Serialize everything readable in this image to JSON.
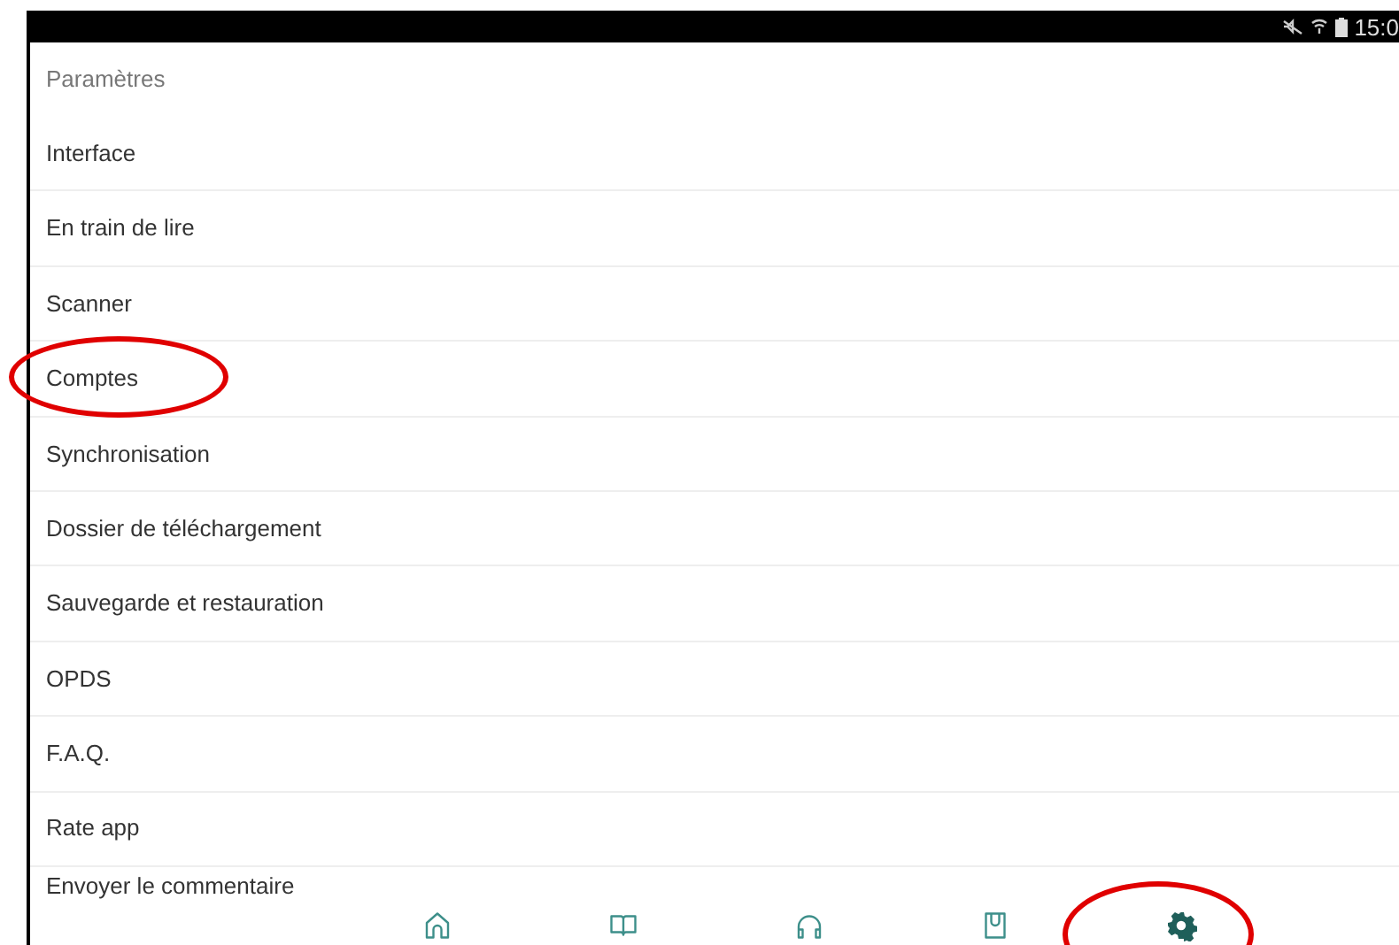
{
  "status_bar": {
    "time": "15:0"
  },
  "header": {
    "title": "Paramètres"
  },
  "items": [
    {
      "label": "Interface",
      "circled": false
    },
    {
      "label": "En train de lire",
      "circled": false
    },
    {
      "label": "Scanner",
      "circled": false
    },
    {
      "label": "Comptes",
      "circled": true
    },
    {
      "label": "Synchronisation",
      "circled": false
    },
    {
      "label": "Dossier de téléchargement",
      "circled": false
    },
    {
      "label": "Sauvegarde et restauration",
      "circled": false
    },
    {
      "label": "OPDS",
      "circled": false
    },
    {
      "label": "F.A.Q.",
      "circled": false
    },
    {
      "label": "Rate app",
      "circled": false
    },
    {
      "label": "Envoyer le commentaire",
      "circled": false
    }
  ],
  "bottom_nav": [
    {
      "kind": "home",
      "selected": false,
      "circled": false
    },
    {
      "kind": "book",
      "selected": false,
      "circled": false
    },
    {
      "kind": "headphones",
      "selected": false,
      "circled": false
    },
    {
      "kind": "bag",
      "selected": false,
      "circled": false
    },
    {
      "kind": "settings",
      "selected": true,
      "circled": true
    }
  ]
}
